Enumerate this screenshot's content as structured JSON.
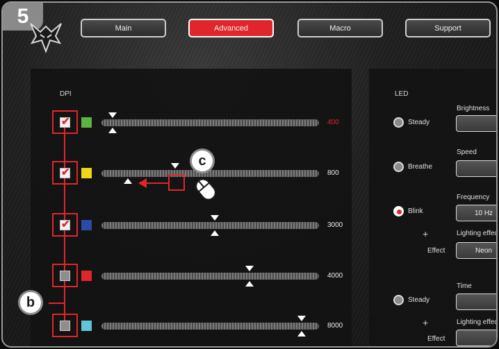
{
  "step_badge": "5",
  "logo": {
    "icon": "trust-gxt-logo-icon"
  },
  "nav": {
    "tabs": [
      {
        "label": "Main",
        "active": false
      },
      {
        "label": "Advanced",
        "active": true
      },
      {
        "label": "Macro",
        "active": false
      },
      {
        "label": "Support",
        "active": false
      }
    ]
  },
  "dpi": {
    "title": "DPI",
    "rows": [
      {
        "checked": true,
        "color": "#5bb543",
        "value": "400",
        "selected": true,
        "level": 0.05
      },
      {
        "checked": true,
        "color": "#f1d71a",
        "value": "800",
        "selected": false,
        "level": 0.34
      },
      {
        "checked": true,
        "color": "#2c4aa8",
        "value": "3000",
        "selected": false,
        "level": 0.52
      },
      {
        "checked": false,
        "color": "#e0262c",
        "value": "4000",
        "selected": false,
        "level": 0.68
      },
      {
        "checked": false,
        "color": "#5fc6d8",
        "value": "8000",
        "selected": false,
        "level": 0.92
      }
    ],
    "ghost_level": 0.12
  },
  "annotations": {
    "b": "b",
    "c": "c"
  },
  "led": {
    "title": "LED",
    "modes": [
      {
        "label": "Steady",
        "on": false
      },
      {
        "label": "Breathe",
        "on": false
      },
      {
        "label": "Blink",
        "on": true
      },
      {
        "label": "Steady",
        "on": false
      }
    ],
    "brightness_label": "Brightness",
    "speed_label": "Speed",
    "frequency_label": "Frequency",
    "frequency_value": "10 Hz",
    "lighting_effect_label_1": "Lighting effec",
    "effect_label_1": "Effect",
    "effect_value_1": "Neon",
    "plus_1": "+",
    "time_label": "Time",
    "lighting_effect_label_2": "Lighting effec",
    "effect_label_2": "Effect",
    "plus_2": "+"
  }
}
